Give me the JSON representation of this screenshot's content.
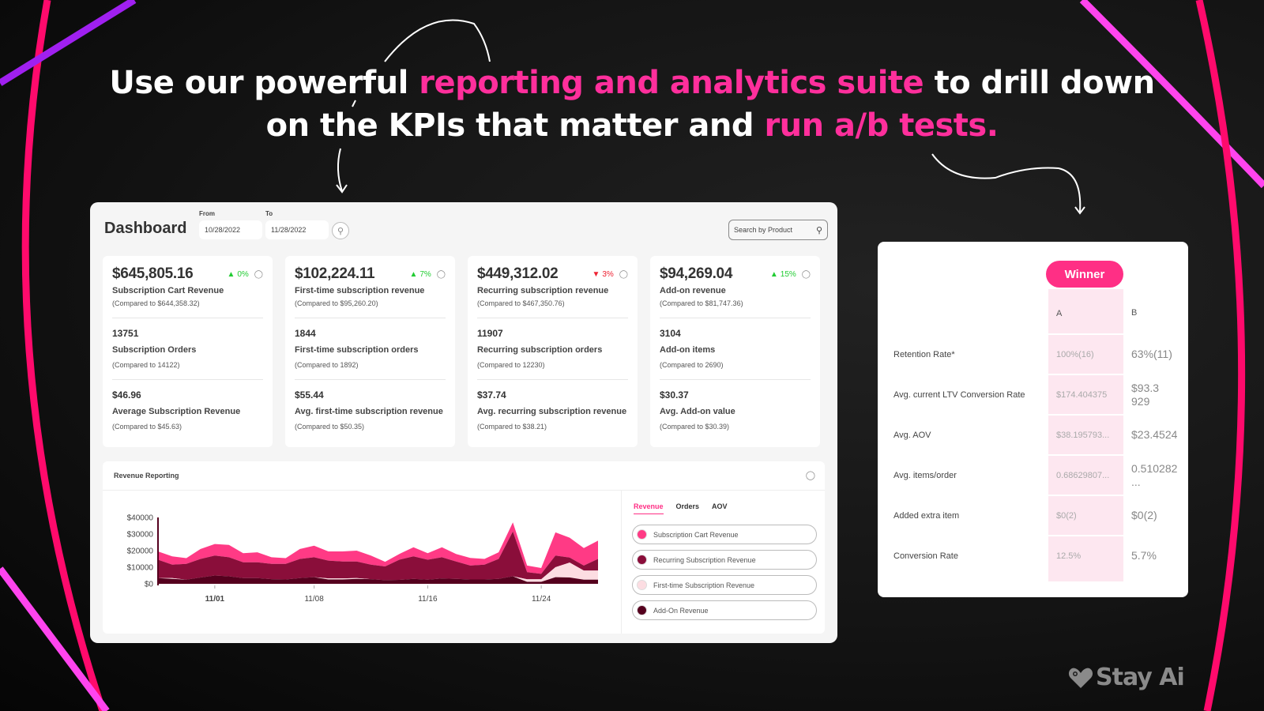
{
  "headline": {
    "part1": "Use our powerful ",
    "highlight1": "reporting and analytics suite",
    "part2": " to drill down",
    "part3": "on the KPIs that matter and ",
    "highlight2": "run a/b tests."
  },
  "dashboard": {
    "title": "Dashboard",
    "from_label": "From",
    "from_value": "10/28/2022",
    "to_label": "To",
    "to_value": "11/28/2022",
    "search_placeholder": "Search by Product",
    "cards": [
      {
        "value": "$645,805.16",
        "delta": "0%",
        "delta_dir": "up",
        "label": "Subscription Cart Revenue",
        "compare": "(Compared to $644,358.32)",
        "sub1_value": "13751",
        "sub1_label": "Subscription Orders",
        "sub1_compare": "(Compared to 14122)",
        "sub2_value": "$46.96",
        "sub2_label": "Average Subscription Revenue",
        "sub2_compare": "(Compared to $45.63)"
      },
      {
        "value": "$102,224.11",
        "delta": "7%",
        "delta_dir": "up",
        "label": "First-time subscription revenue",
        "compare": "(Compared to $95,260.20)",
        "sub1_value": "1844",
        "sub1_label": "First-time subscription orders",
        "sub1_compare": "(Compared to 1892)",
        "sub2_value": "$55.44",
        "sub2_label": "Avg. first-time subscription revenue",
        "sub2_compare": "(Compared to $50.35)"
      },
      {
        "value": "$449,312.02",
        "delta": "3%",
        "delta_dir": "down",
        "label": "Recurring subscription revenue",
        "compare": "(Compared to $467,350.76)",
        "sub1_value": "11907",
        "sub1_label": "Recurring subscription orders",
        "sub1_compare": "(Compared to 12230)",
        "sub2_value": "$37.74",
        "sub2_label": "Avg. recurring subscription revenue",
        "sub2_compare": "(Compared to $38.21)"
      },
      {
        "value": "$94,269.04",
        "delta": "15%",
        "delta_dir": "up",
        "label": "Add-on revenue",
        "compare": "(Compared to $81,747.36)",
        "sub1_value": "3104",
        "sub1_label": "Add-on items",
        "sub1_compare": "(Compared to 2690)",
        "sub2_value": "$30.37",
        "sub2_label": "Avg. Add-on value",
        "sub2_compare": "(Compared to $30.39)"
      }
    ],
    "revenue_reporting": {
      "title": "Revenue Reporting",
      "tabs": [
        {
          "label": "Revenue",
          "active": true
        },
        {
          "label": "Orders",
          "active": false
        },
        {
          "label": "AOV",
          "active": false
        }
      ],
      "legend": [
        {
          "label": "Subscription Cart Revenue",
          "color": "#ff3a85"
        },
        {
          "label": "Recurring Subscription Revenue",
          "color": "#8a0e3a"
        },
        {
          "label": "First-time Subscription Revenue",
          "color": "#fcdde2"
        },
        {
          "label": "Add-On Revenue",
          "color": "#55001e"
        }
      ]
    }
  },
  "chart_data": {
    "type": "area",
    "stacked": true,
    "title": "Revenue Reporting",
    "xlabel": "",
    "ylabel": "",
    "ylim": [
      0,
      40000
    ],
    "yticks": [
      "$40000",
      "$30000",
      "$20000",
      "$10000",
      "$0"
    ],
    "ytick_values": [
      40000,
      30000,
      20000,
      10000,
      0
    ],
    "xticks": [
      {
        "label": "11/01",
        "index": 4,
        "bold": true
      },
      {
        "label": "11/08",
        "index": 11,
        "bold": false
      },
      {
        "label": "11/16",
        "index": 19,
        "bold": false
      },
      {
        "label": "11/24",
        "index": 27,
        "bold": false
      }
    ],
    "x": [
      "10/28",
      "10/29",
      "10/30",
      "10/31",
      "11/01",
      "11/02",
      "11/03",
      "11/04",
      "11/05",
      "11/06",
      "11/07",
      "11/08",
      "11/09",
      "11/10",
      "11/11",
      "11/12",
      "11/13",
      "11/14",
      "11/15",
      "11/16",
      "11/17",
      "11/18",
      "11/19",
      "11/20",
      "11/21",
      "11/22",
      "11/23",
      "11/24",
      "11/25",
      "11/26",
      "11/27",
      "11/28"
    ],
    "series": [
      {
        "name": "Add-On Revenue",
        "color": "#55001e",
        "values": [
          3500,
          3000,
          2500,
          3800,
          5000,
          4500,
          3500,
          3500,
          2800,
          2600,
          3500,
          4000,
          2600,
          2600,
          3000,
          2800,
          2200,
          2400,
          3000,
          2500,
          3200,
          3000,
          2600,
          2600,
          3000,
          4500,
          1200,
          1200,
          4000,
          3800,
          2500,
          2500
        ]
      },
      {
        "name": "First-time Subscription Revenue",
        "color": "#fcdde2",
        "values": [
          0,
          500,
          0,
          0,
          0,
          0,
          0,
          0,
          0,
          0,
          0,
          0,
          700,
          700,
          500,
          0,
          0,
          0,
          0,
          0,
          0,
          0,
          0,
          0,
          0,
          0,
          1500,
          1500,
          6000,
          9000,
          5500,
          5500
        ]
      },
      {
        "name": "Recurring Subscription Revenue",
        "color": "#8a0e3a",
        "values": [
          11000,
          8000,
          9500,
          11200,
          12000,
          11500,
          9500,
          9500,
          9200,
          9400,
          11500,
          12000,
          10700,
          10200,
          10000,
          8700,
          8300,
          12100,
          13500,
          12000,
          12800,
          10500,
          8400,
          8900,
          12000,
          27000,
          4300,
          3300,
          7000,
          3000,
          3000,
          7000
        ]
      },
      {
        "name": "Subscription Cart Revenue",
        "color": "#ff3a85",
        "values": [
          5000,
          5000,
          3500,
          6000,
          7000,
          7500,
          5500,
          6000,
          4000,
          3500,
          6000,
          7000,
          5500,
          6000,
          6500,
          5500,
          2800,
          3500,
          5500,
          4000,
          6000,
          4500,
          4600,
          3500,
          4000,
          5500,
          4000,
          3500,
          14000,
          12000,
          10500,
          11000
        ]
      }
    ]
  },
  "ab_test": {
    "winner_label": "Winner",
    "col_a": "A",
    "col_b": "B",
    "rows": [
      {
        "metric": "Retention Rate*",
        "a": "100%(16)",
        "b": "63%(11)"
      },
      {
        "metric": "Avg. current LTV Conversion Rate",
        "a": "$174.404375",
        "b": "$93.3 929"
      },
      {
        "metric": "Avg. AOV",
        "a": "$38.195793...",
        "b": "$23.4524"
      },
      {
        "metric": "Avg. items/order",
        "a": "0.68629807...",
        "b": "0.510282 ..."
      },
      {
        "metric": "Added extra item",
        "a": "$0(2)",
        "b": "$0(2)"
      },
      {
        "metric": "Conversion Rate",
        "a": "12.5%",
        "b": "5.7%"
      }
    ]
  },
  "brand": {
    "name": "Stay Ai",
    "logo_icon": "heart-icon"
  },
  "colors": {
    "accent_pink": "#ff2f85",
    "headline_pink": "#ff2f9c",
    "up_green": "#22cc33",
    "down_red": "#ee2233"
  }
}
